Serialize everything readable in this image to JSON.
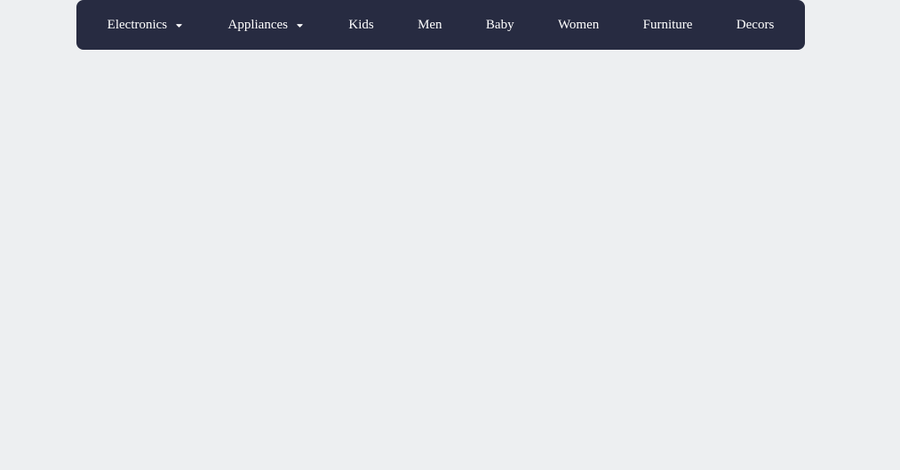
{
  "nav": {
    "items": [
      {
        "label": "Electronics",
        "has_dropdown": true
      },
      {
        "label": "Appliances",
        "has_dropdown": true
      },
      {
        "label": "Kids",
        "has_dropdown": false
      },
      {
        "label": "Men",
        "has_dropdown": false
      },
      {
        "label": "Baby",
        "has_dropdown": false
      },
      {
        "label": "Women",
        "has_dropdown": false
      },
      {
        "label": "Furniture",
        "has_dropdown": false
      },
      {
        "label": "Decors",
        "has_dropdown": false
      }
    ]
  }
}
